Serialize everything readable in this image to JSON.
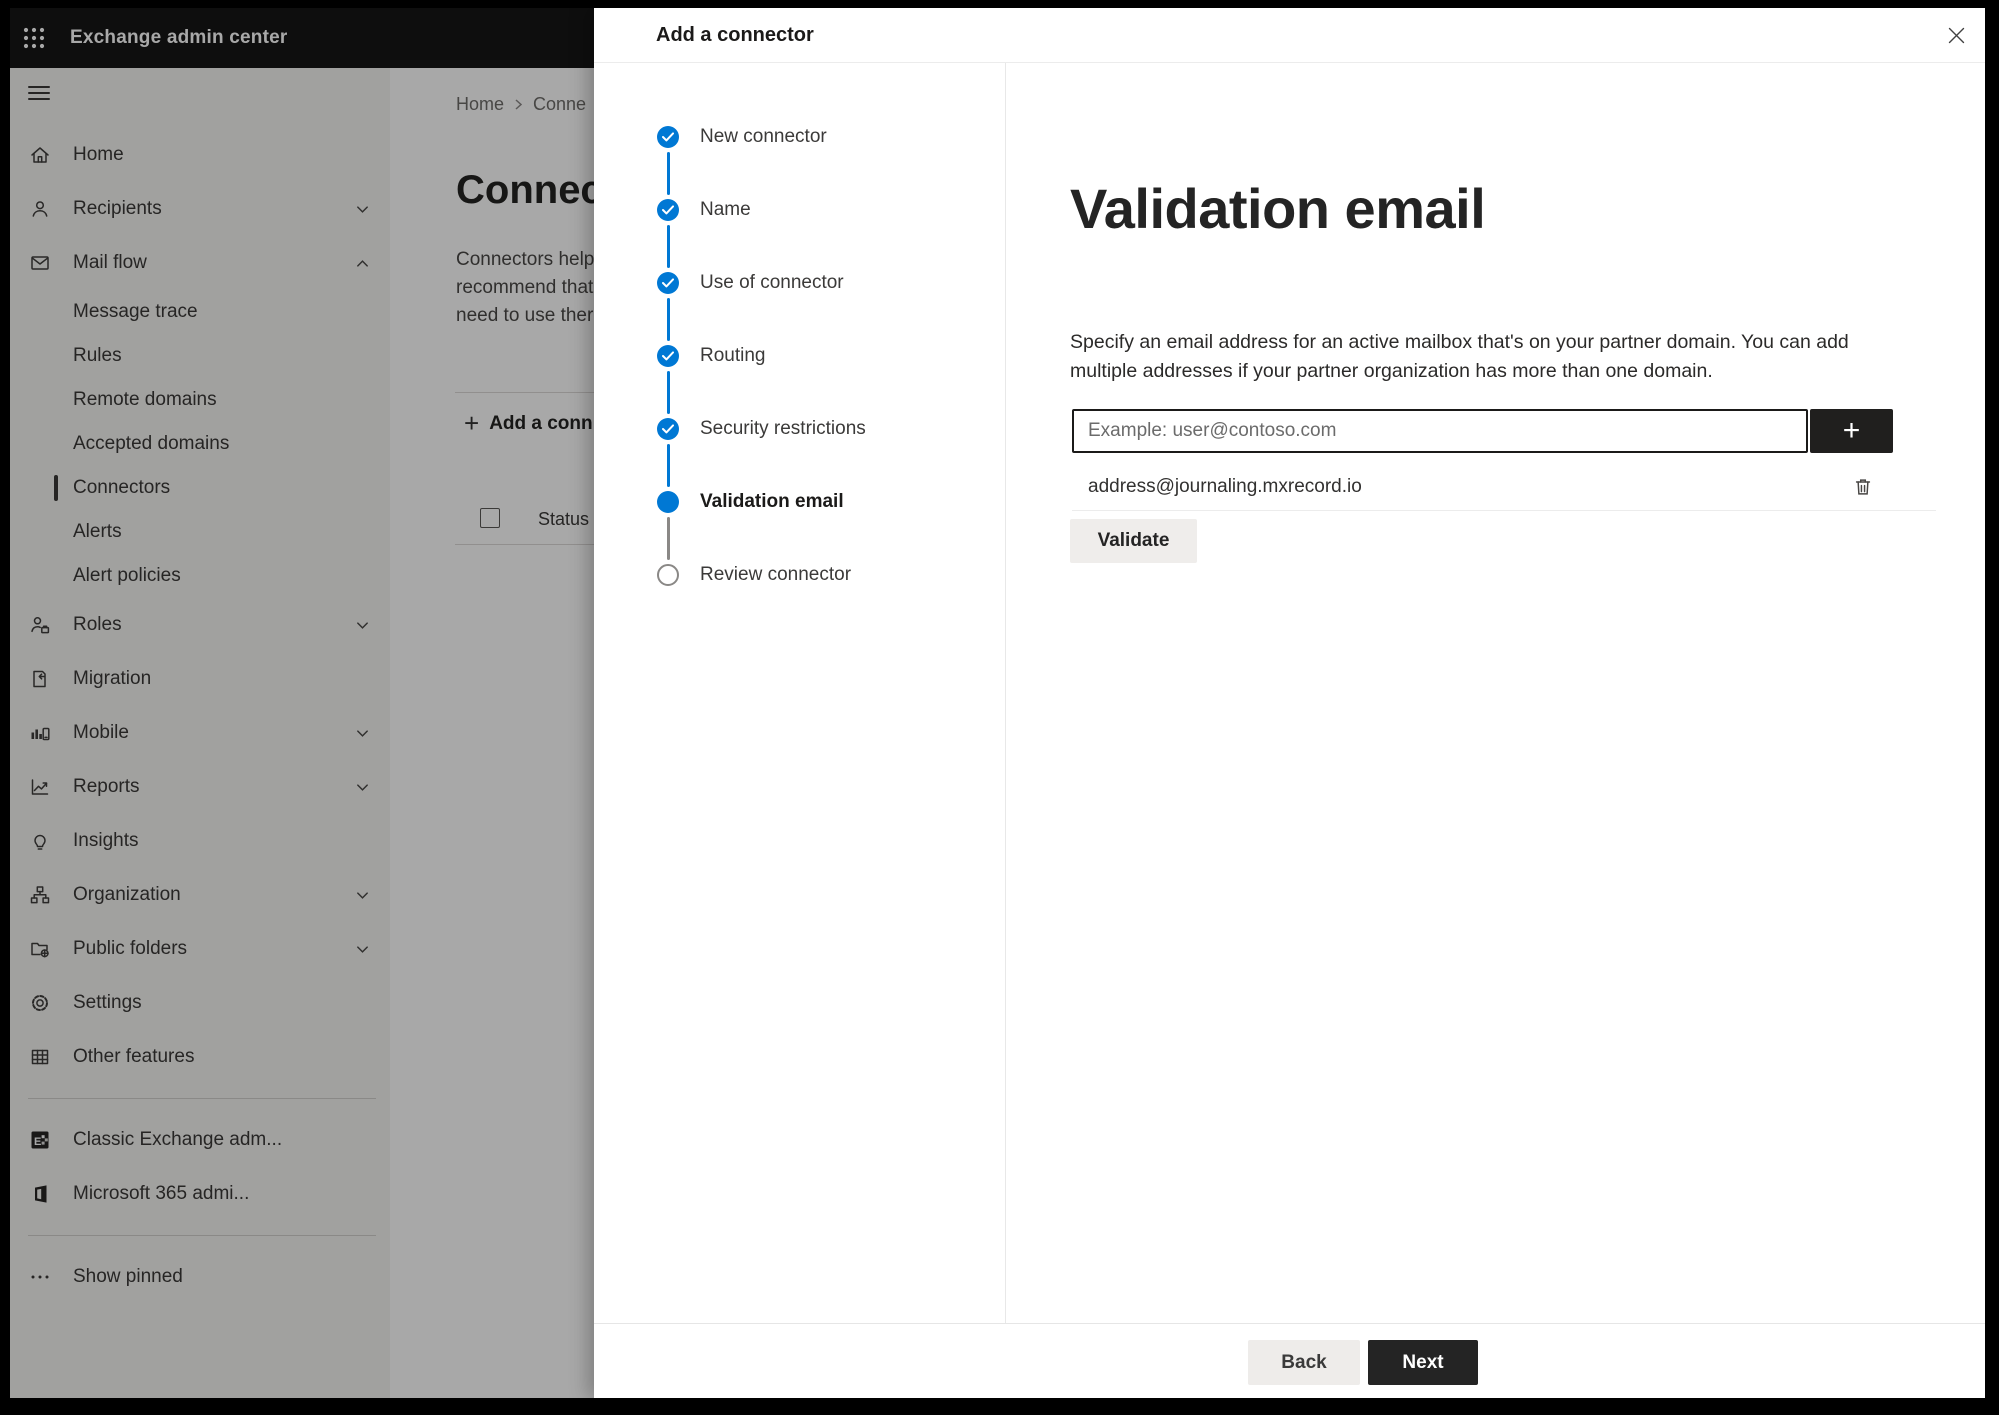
{
  "topbar": {
    "title": "Exchange admin center"
  },
  "sidebar": {
    "items": [
      {
        "id": "home",
        "label": "Home"
      },
      {
        "id": "recipients",
        "label": "Recipients",
        "expandable": true,
        "expanded": false
      },
      {
        "id": "mail-flow",
        "label": "Mail flow",
        "expandable": true,
        "expanded": true,
        "children": [
          {
            "label": "Message trace"
          },
          {
            "label": "Rules"
          },
          {
            "label": "Remote domains"
          },
          {
            "label": "Accepted domains"
          },
          {
            "label": "Connectors",
            "selected": true
          },
          {
            "label": "Alerts"
          },
          {
            "label": "Alert policies"
          }
        ]
      },
      {
        "id": "roles",
        "label": "Roles",
        "expandable": true
      },
      {
        "id": "migration",
        "label": "Migration"
      },
      {
        "id": "mobile",
        "label": "Mobile",
        "expandable": true
      },
      {
        "id": "reports",
        "label": "Reports",
        "expandable": true
      },
      {
        "id": "insights",
        "label": "Insights"
      },
      {
        "id": "organization",
        "label": "Organization",
        "expandable": true
      },
      {
        "id": "public-folders",
        "label": "Public folders",
        "expandable": true
      },
      {
        "id": "settings",
        "label": "Settings"
      },
      {
        "id": "other-features",
        "label": "Other features"
      }
    ],
    "footer_items": [
      {
        "label": "Classic Exchange adm..."
      },
      {
        "label": "Microsoft 365 admi..."
      }
    ],
    "show_pinned_label": "Show pinned"
  },
  "background_page": {
    "breadcrumb": [
      "Home",
      "Conne"
    ],
    "title_fragment": "Connect",
    "body_lines": [
      "Connectors help",
      "recommend that",
      "need to use ther"
    ],
    "toolbar": {
      "add_button_label": "Add a conn"
    },
    "table": {
      "columns": [
        "Status"
      ]
    }
  },
  "panel": {
    "title": "Add a connector",
    "stepper": {
      "steps": [
        {
          "label": "New connector",
          "state": "completed"
        },
        {
          "label": "Name",
          "state": "completed"
        },
        {
          "label": "Use of connector",
          "state": "completed"
        },
        {
          "label": "Routing",
          "state": "completed"
        },
        {
          "label": "Security restrictions",
          "state": "completed"
        },
        {
          "label": "Validation email",
          "state": "current"
        },
        {
          "label": "Review connector",
          "state": "upcoming"
        }
      ]
    },
    "content": {
      "heading": "Validation email",
      "description": "Specify an email address for an active mailbox that's on your partner domain. You can add multiple addresses if your partner organization has more than one domain.",
      "email_input": {
        "value": "",
        "placeholder": "Example: user@contoso.com"
      },
      "add_button_label": "+",
      "addresses": [
        "address@journaling.mxrecord.io"
      ],
      "validate_button_label": "Validate"
    },
    "footer": {
      "back_label": "Back",
      "next_label": "Next"
    }
  },
  "colors": {
    "accent": "#0078d4",
    "dark_button": "#242424",
    "upcoming_ring": "#8a8886",
    "topbar_bg": "#161616"
  }
}
